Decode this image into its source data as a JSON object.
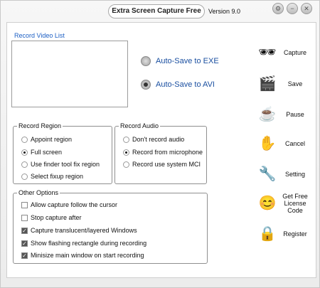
{
  "app": {
    "title": "Extra Screen Capture Free",
    "version": "Version 9.0"
  },
  "video_list": {
    "label": "Record Video List"
  },
  "autosave": {
    "exe_label": "Auto-Save to EXE",
    "avi_label": "Auto-Save to AVI",
    "selected": "avi"
  },
  "record_region": {
    "title": "Record Region",
    "options": [
      "Appoint region",
      "Full screen",
      "Use finder tool fix region",
      "Select fixup region"
    ],
    "selected_index": 1
  },
  "record_audio": {
    "title": "Record Audio",
    "options": [
      "Don't record audio",
      "Record from  microphone",
      "Record use system MCI"
    ],
    "selected_index": 1
  },
  "other_options": {
    "title": "Other Options",
    "items": [
      {
        "label": "Allow capture follow the cursor",
        "checked": false
      },
      {
        "label": "Stop capture after",
        "checked": false
      },
      {
        "label": "Capture translucent/layered Windows",
        "checked": true
      },
      {
        "label": "Show flashing rectangle during recording",
        "checked": true
      },
      {
        "label": "Minisize main window on start recording",
        "checked": true
      }
    ]
  },
  "sidebar": [
    {
      "label": "Capture",
      "icon": "🕶"
    },
    {
      "label": "Save",
      "icon": "🎬"
    },
    {
      "label": "Pause",
      "icon": "☕"
    },
    {
      "label": "Cancel",
      "icon": "✋"
    },
    {
      "label": "Setting",
      "icon": "🔧"
    },
    {
      "label": "Get Free License Code",
      "icon": "😊"
    },
    {
      "label": "Register",
      "icon": "🔒"
    }
  ],
  "window_buttons": [
    "⚙",
    "−",
    "✕"
  ]
}
